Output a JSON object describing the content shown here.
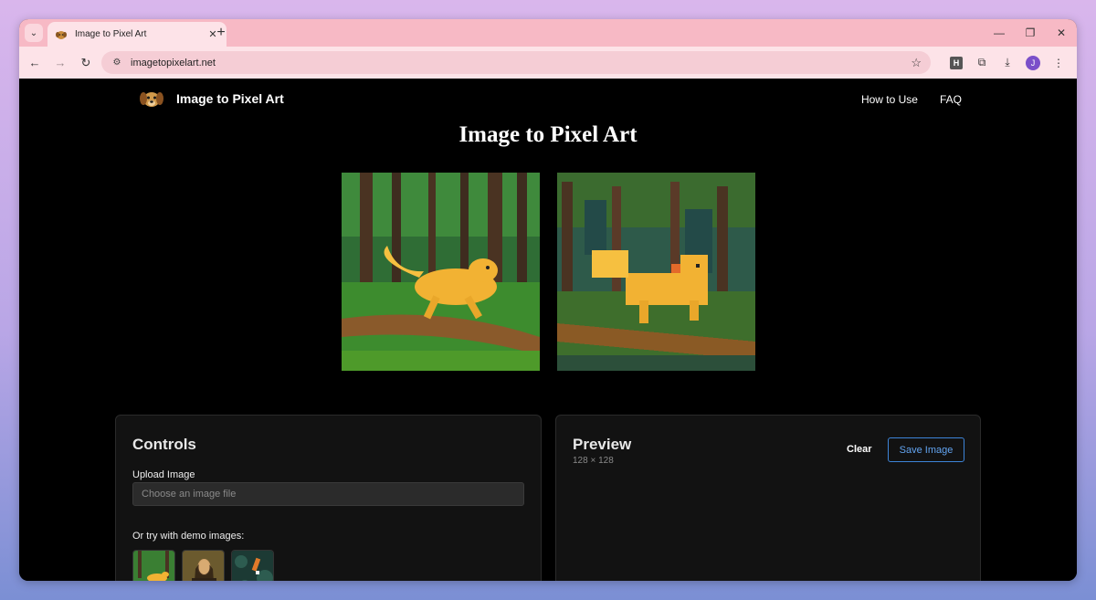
{
  "browser": {
    "tab_title": "Image to Pixel Art",
    "url": "imagetopixelart.net",
    "extension_letter": "H",
    "profile_initial": "J"
  },
  "site": {
    "brand_name": "Image to Pixel Art",
    "nav": [
      "How to Use",
      "FAQ"
    ],
    "hero_title": "Image to Pixel Art"
  },
  "controls": {
    "title": "Controls",
    "upload_label": "Upload Image",
    "file_placeholder": "Choose an image file",
    "demo_label": "Or try with demo images:"
  },
  "preview": {
    "title": "Preview",
    "size": "128 × 128",
    "clear_label": "Clear",
    "save_label": "Save Image"
  },
  "colors": {
    "accent": "#3d84d8",
    "tab_strip": "#f7b9c5",
    "toolbar": "#fde3e8"
  }
}
